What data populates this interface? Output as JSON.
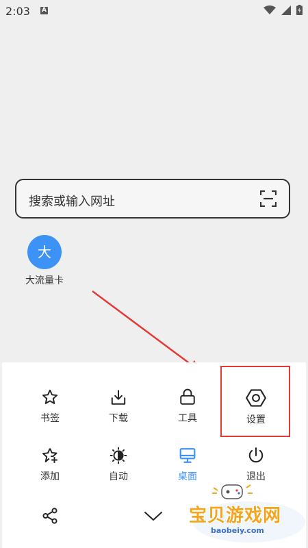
{
  "status": {
    "time": "2:03",
    "a_label": "A"
  },
  "search": {
    "placeholder": "搜索或输入网址"
  },
  "shortcuts": [
    {
      "icon_text": "大",
      "label": "大流量卡"
    }
  ],
  "menu": {
    "row1": [
      {
        "label": "书签",
        "icon": "star-icon"
      },
      {
        "label": "下载",
        "icon": "download-icon"
      },
      {
        "label": "工具",
        "icon": "toolbox-icon"
      },
      {
        "label": "设置",
        "icon": "settings-hexagon-icon"
      }
    ],
    "row2": [
      {
        "label": "添加",
        "icon": "star-plus-icon"
      },
      {
        "label": "自动",
        "icon": "auto-brightness-icon"
      },
      {
        "label": "桌面",
        "icon": "desktop-icon",
        "active": true
      },
      {
        "label": "退出",
        "icon": "power-icon"
      }
    ],
    "row3": [
      {
        "icon": "share-icon"
      },
      {
        "icon": "chevron-down-icon"
      }
    ]
  },
  "watermark": {
    "text": "宝贝游戏网",
    "url": "baobeiy.com"
  },
  "colors": {
    "accent": "#3d93f5",
    "annotation": "#e53935",
    "watermark": "#f3a51d"
  }
}
